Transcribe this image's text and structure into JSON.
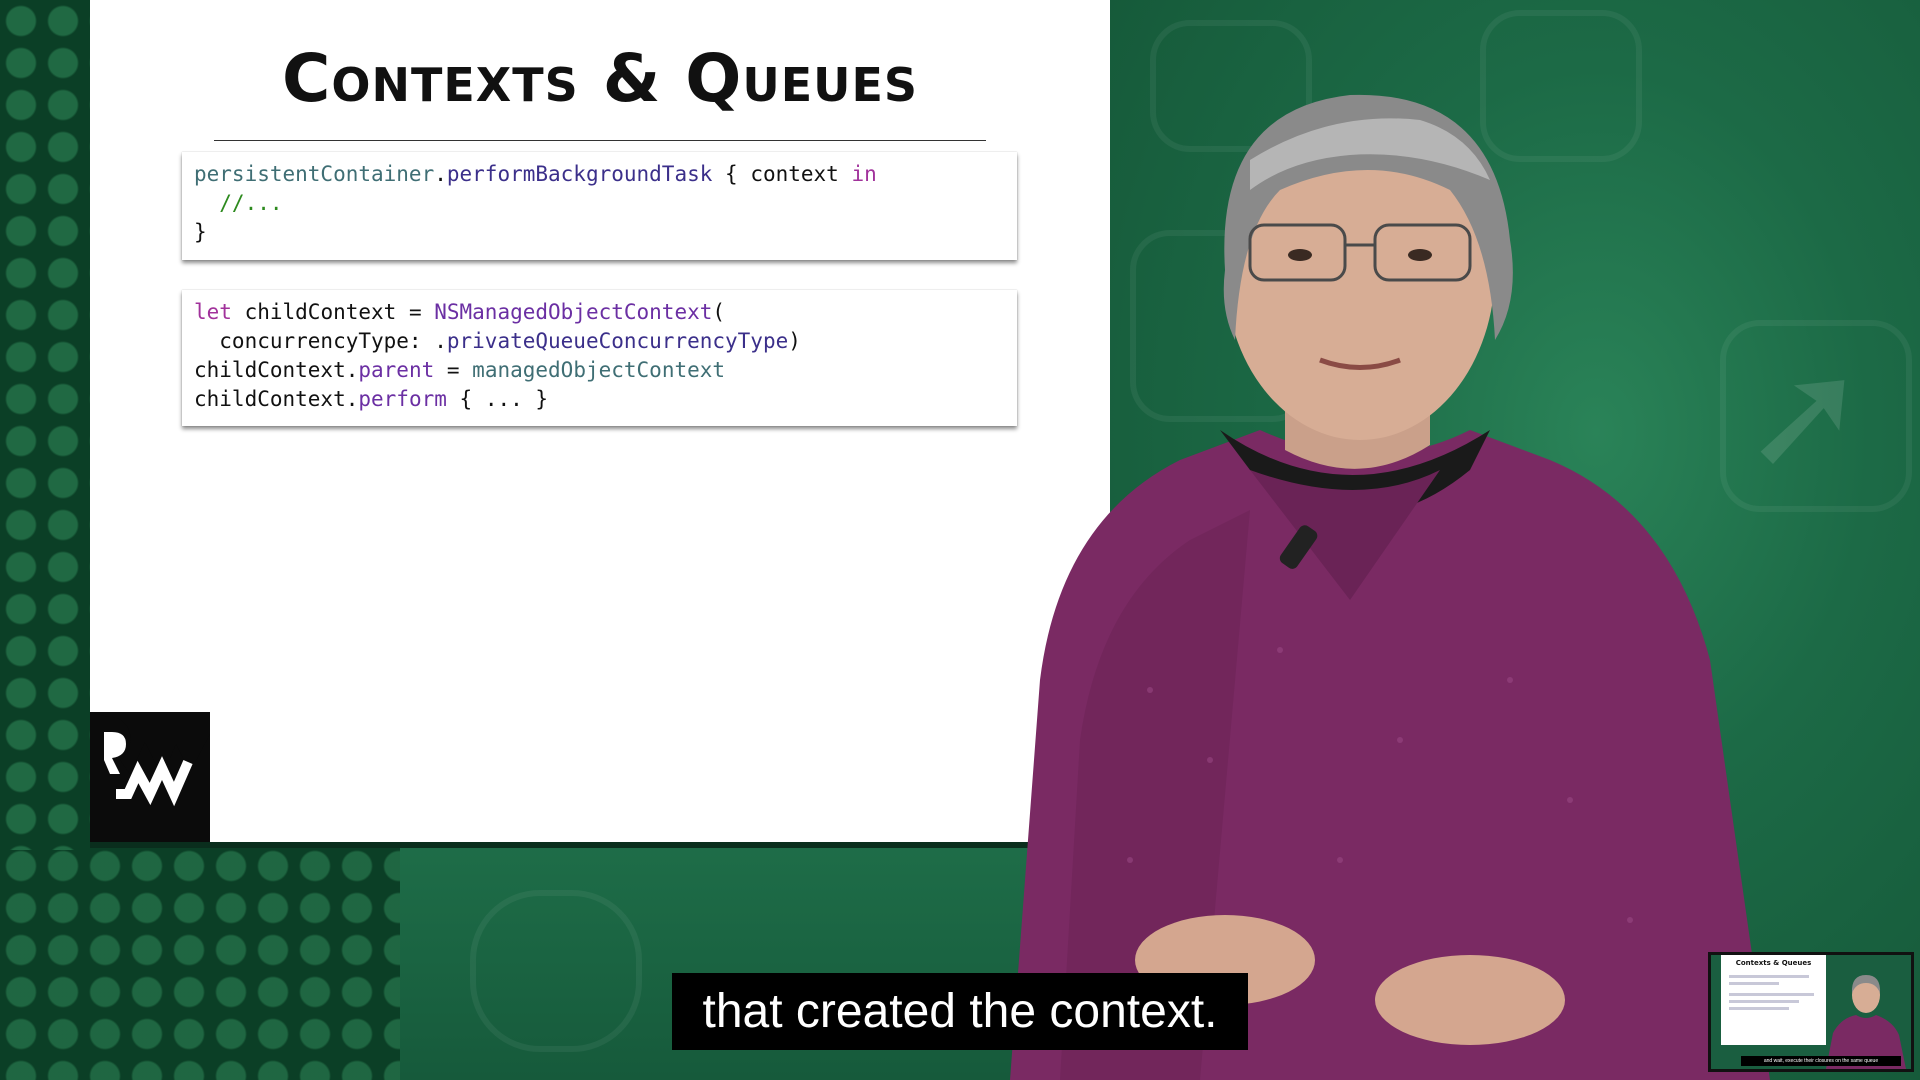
{
  "slide": {
    "title": "Contexts & Queues",
    "code_block_1": {
      "line1": {
        "part1": "persistentContainer",
        "part2": ".",
        "part3": "performBackgroundTask",
        "part4": " { context ",
        "part5": "in"
      },
      "line2": "  //...",
      "line3": "}"
    },
    "code_block_2": {
      "line1": {
        "kw": "let",
        "part1": " childContext = ",
        "part2": "NSManagedObjectContext",
        "part3": "("
      },
      "line2": {
        "part1": "  concurrencyType: .",
        "part2": "privateQueueConcurrencyType",
        "part3": ")"
      },
      "line3": {
        "part1": "childContext.",
        "part2": "parent",
        "part3": " = ",
        "part4": "managedObjectContext"
      },
      "line4": {
        "part1": "childContext.",
        "part2": "perform",
        "part3": " { ... }"
      }
    }
  },
  "caption": "that created the context.",
  "thumbnail": {
    "title": "Contexts & Queues",
    "caption": "and wait, execute their closures on the same queue"
  },
  "icons": {
    "logo": "rw-logo-icon",
    "background": "swift-logo-icon"
  },
  "colors": {
    "background_green": "#1c6a46",
    "slide_bg": "#ffffff",
    "sweater": "#7a2a63",
    "keyword": "#a1329b",
    "comment": "#2d8a1e"
  }
}
